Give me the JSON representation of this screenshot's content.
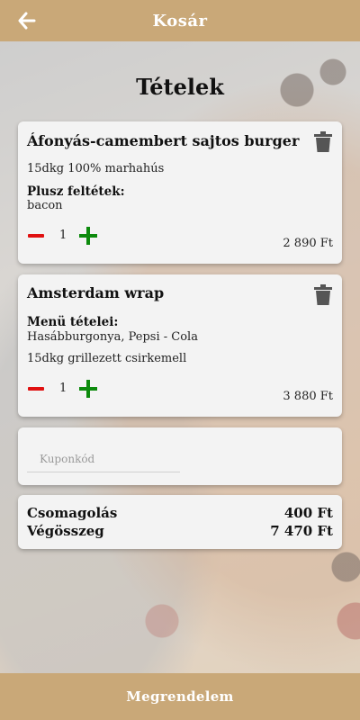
{
  "header": {
    "title": "Kosár",
    "back_icon": "arrow-left-icon"
  },
  "section_title": "Tételek",
  "items": [
    {
      "name": "Áfonyás-camembert sajtos burger",
      "description": "15dkg 100% marhahús",
      "extras_label": "Plusz feltétek:",
      "extras_value": "bacon",
      "quantity": "1",
      "price": "2 890 Ft"
    },
    {
      "name": "Amsterdam wrap",
      "menu_label": "Menü tételei:",
      "menu_value": "Hasábburgonya, Pepsi - Cola",
      "description": "15dkg grillezett csirkemell",
      "quantity": "1",
      "price": "3 880 Ft"
    }
  ],
  "coupon": {
    "placeholder": "Kuponkód",
    "value": ""
  },
  "summary": {
    "packaging_label": "Csomagolás",
    "packaging_value": "400 Ft",
    "total_label": "Végösszeg",
    "total_value": "7 470 Ft"
  },
  "footer": {
    "order_label": "Megrendelem"
  },
  "colors": {
    "accent": "#c9a878",
    "minus": "#e01010",
    "plus": "#0c8a0c"
  }
}
